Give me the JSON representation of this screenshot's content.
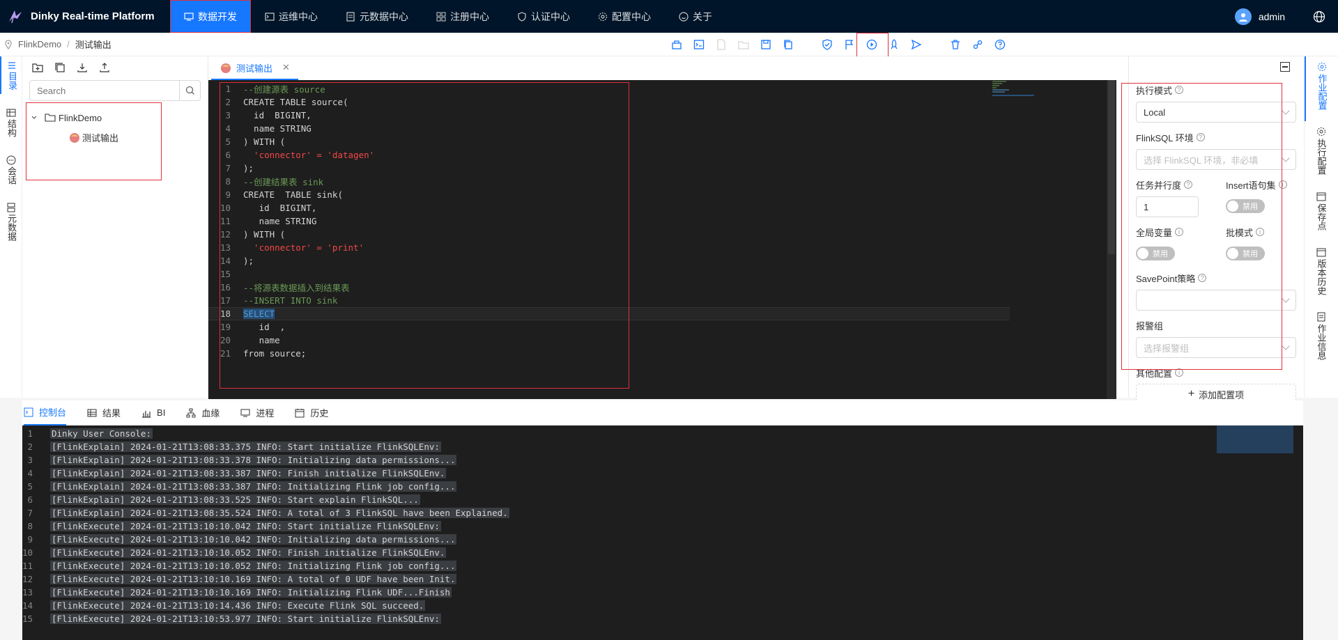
{
  "app": {
    "brand": "Dinky Real-time Platform"
  },
  "nav": [
    {
      "label": "数据开发",
      "icon": "monitor-icon",
      "active": true
    },
    {
      "label": "运维中心",
      "icon": "terminal-icon"
    },
    {
      "label": "元数据中心",
      "icon": "file-icon"
    },
    {
      "label": "注册中心",
      "icon": "grid-icon"
    },
    {
      "label": "认证中心",
      "icon": "shield-icon"
    },
    {
      "label": "配置中心",
      "icon": "gear-icon"
    },
    {
      "label": "关于",
      "icon": "smile-icon"
    }
  ],
  "user": {
    "name": "admin"
  },
  "breadcrumb": {
    "root": "FlinkDemo",
    "current": "测试输出"
  },
  "left_tabs": [
    "目录",
    "结构",
    "会话",
    "元数据"
  ],
  "tree": {
    "search_placeholder": "Search",
    "folder": "FlinkDemo",
    "file": "测试输出"
  },
  "editor": {
    "tab_label": "测试输出",
    "current_line": 18,
    "lines": [
      "--创建源表 source",
      "CREATE TABLE source(",
      "  id  BIGINT,",
      "  name STRING",
      ") WITH (",
      "  'connector' = 'datagen'",
      ");",
      "--创建结果表 sink",
      "CREATE  TABLE sink(",
      "   id  BIGINT,",
      "   name STRING",
      ") WITH (",
      "  'connector' = 'print'",
      ");",
      "",
      "--将源表数据插入到结果表",
      "--INSERT INTO sink",
      "SELECT",
      "   id  ,",
      "   name",
      "from source;"
    ]
  },
  "config": {
    "exec_mode_label": "执行模式",
    "exec_mode_value": "Local",
    "env_label": "FlinkSQL 环境",
    "env_placeholder": "选择 FlinkSQL 环境，非必填",
    "parallel_label": "任务并行度",
    "parallel_value": "1",
    "insert_label": "Insert语句集",
    "insert_toggle": "禁用",
    "global_var_label": "全局变量",
    "global_var_toggle": "禁用",
    "batch_label": "批模式",
    "batch_toggle": "禁用",
    "savepoint_label": "SavePoint策略",
    "alarm_label": "报警组",
    "alarm_placeholder": "选择报警组",
    "other_label": "其他配置",
    "add_label": "添加配置项"
  },
  "right_tabs": [
    "作业配置",
    "执行配置",
    "保存点",
    "版本历史",
    "作业信息"
  ],
  "bottom_tabs": [
    "控制台",
    "结果",
    "BI",
    "血缘",
    "进程",
    "历史"
  ],
  "console": [
    "Dinky User Console:",
    "[FlinkExplain] 2024-01-21T13:08:33.375 INFO: Start initialize FlinkSQLEnv:",
    "[FlinkExplain] 2024-01-21T13:08:33.378 INFO: Initializing data permissions...",
    "[FlinkExplain] 2024-01-21T13:08:33.387 INFO: Finish initialize FlinkSQLEnv.",
    "[FlinkExplain] 2024-01-21T13:08:33.387 INFO: Initializing Flink job config...",
    "[FlinkExplain] 2024-01-21T13:08:33.525 INFO: Start explain FlinkSQL...",
    "[FlinkExplain] 2024-01-21T13:08:35.524 INFO: A total of 3 FlinkSQL have been Explained.",
    "[FlinkExecute] 2024-01-21T13:10:10.042 INFO: Start initialize FlinkSQLEnv:",
    "[FlinkExecute] 2024-01-21T13:10:10.042 INFO: Initializing data permissions...",
    "[FlinkExecute] 2024-01-21T13:10:10.052 INFO: Finish initialize FlinkSQLEnv.",
    "[FlinkExecute] 2024-01-21T13:10:10.052 INFO: Initializing Flink job config...",
    "[FlinkExecute] 2024-01-21T13:10:10.169 INFO: A total of 0 UDF have been Init.",
    "[FlinkExecute] 2024-01-21T13:10:10.169 INFO: Initializing Flink UDF...Finish",
    "[FlinkExecute] 2024-01-21T13:10:14.436 INFO: Execute Flink SQL succeed.",
    "[FlinkExecute] 2024-01-21T13:10:53.977 INFO: Start initialize FlinkSQLEnv:"
  ]
}
